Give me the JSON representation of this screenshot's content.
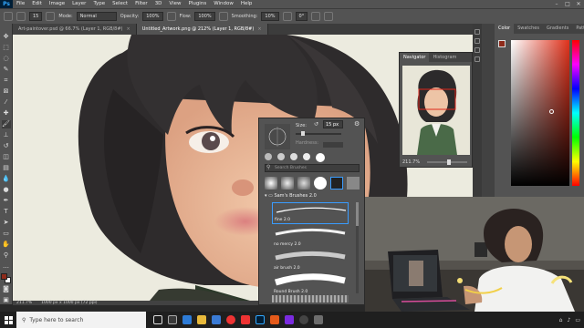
{
  "app": {
    "logo": "Ps"
  },
  "menu": [
    "File",
    "Edit",
    "Image",
    "Layer",
    "Type",
    "Select",
    "Filter",
    "3D",
    "View",
    "Plugins",
    "Window",
    "Help"
  ],
  "options": {
    "mode_label": "Mode:",
    "mode_value": "Normal",
    "opacity_label": "Opacity:",
    "opacity_value": "100%",
    "flow_label": "Flow:",
    "flow_value": "100%",
    "smoothing_label": "Smoothing:",
    "smoothing_value": "10%",
    "angle_value": "0°"
  },
  "documents": [
    {
      "label": "Art-paintover.psd @ 66.7% (Layer 1, RGB/8#)"
    },
    {
      "label": "Untitled_Artwork.png @ 212% (Layer 1, RGB/8#)"
    }
  ],
  "status": {
    "zoom": "211.7%",
    "dims": "1000 px x 1000 px (72 ppi)"
  },
  "navigator": {
    "tabs": [
      "Navigator",
      "Histogram"
    ],
    "zoom": "211.7%"
  },
  "color_panel": {
    "tabs": [
      "Color",
      "Swatches",
      "Gradients",
      "Patterns"
    ]
  },
  "brush_panel": {
    "size_label": "Size:",
    "size_value": "15 px",
    "hardness_label": "Hardness:",
    "search_placeholder": "Search Brushes",
    "folder_name": "Sam's Brushes 2.0",
    "brushes": [
      {
        "name": "fine 2.0"
      },
      {
        "name": "no mercy 2.0"
      },
      {
        "name": "air brush 2.0"
      },
      {
        "name": "Round Brush 2.0"
      }
    ]
  },
  "taskbar": {
    "search_placeholder": "Type here to search"
  },
  "colors": {
    "foreground": "#8e2b1b",
    "background": "#ffffff",
    "accent": "#31a8ff"
  }
}
